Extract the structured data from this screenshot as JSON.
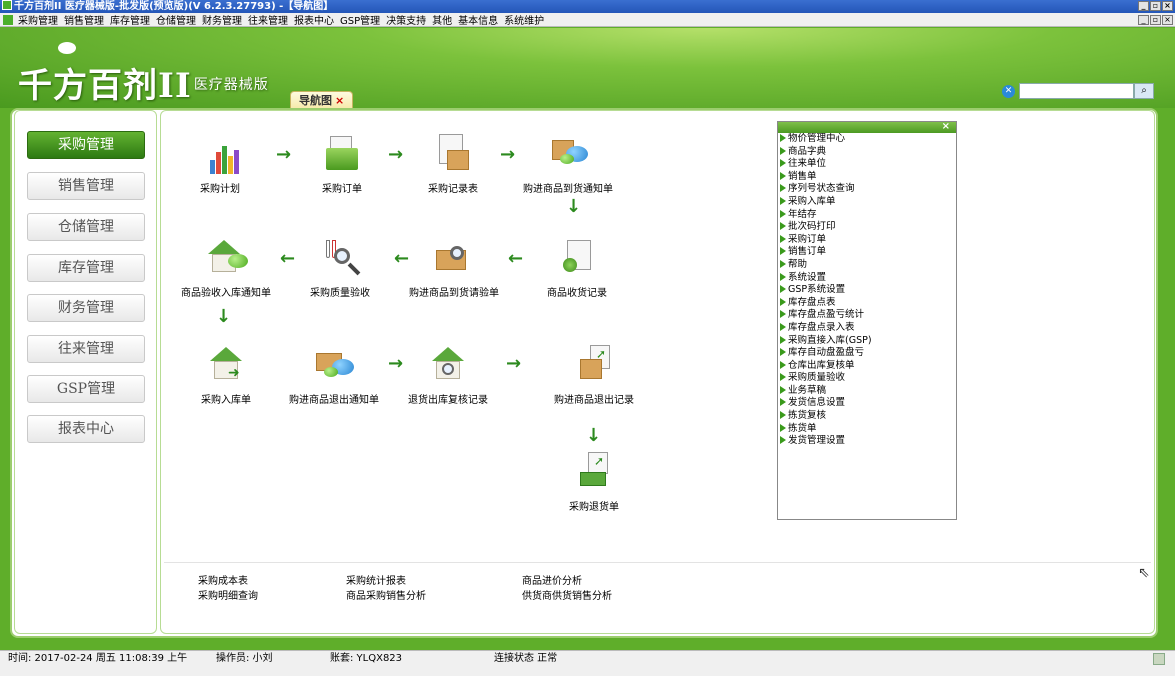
{
  "window": {
    "title": "千方百剂II 医疗器械版-批发版(预览版)(V 6.2.3.27793)  -【导航图】",
    "controls": [
      "_",
      "▫",
      "×"
    ]
  },
  "menubar": {
    "items": [
      "采购管理",
      "销售管理",
      "库存管理",
      "仓储管理",
      "财务管理",
      "往来管理",
      "报表中心",
      "GSP管理",
      "决策支持",
      "其他",
      "基本信息",
      "系统维护"
    ]
  },
  "header": {
    "logo_text": "千方百剂",
    "logo_roman": "II",
    "logo_sub": "医疗器械版",
    "tab_label": "导航图",
    "tab_close": "×",
    "search": {
      "placeholder": "",
      "value": ""
    }
  },
  "left_nav": {
    "items": [
      {
        "label": "采购管理",
        "active": true
      },
      {
        "label": "销售管理",
        "active": false
      },
      {
        "label": "仓储管理",
        "active": false
      },
      {
        "label": "库存管理",
        "active": false
      },
      {
        "label": "财务管理",
        "active": false
      },
      {
        "label": "往来管理",
        "active": false
      },
      {
        "label": "GSP管理",
        "active": false
      },
      {
        "label": "报表中心",
        "active": false
      }
    ]
  },
  "workflow": {
    "purchase_plan": "采购计划",
    "purchase_order": "采购订单",
    "purchase_record": "采购记录表",
    "arrival_notice": "购进商品到货通知单",
    "receipt_record": "商品收货记录",
    "inspection_request": "购进商品到货请验单",
    "quality_check": "采购质量验收",
    "inbound_notice": "商品验收入库通知单",
    "stock_in": "采购入库单",
    "return_notice": "购进商品退出通知单",
    "return_review": "退货出库复核记录",
    "return_record": "购进商品退出记录",
    "return_order": "采购退货单"
  },
  "side_list": {
    "close": "×",
    "items": [
      "物价管理中心",
      "商品字典",
      "往来单位",
      "销售单",
      "序列号状态查询",
      "采购入库单",
      "年结存",
      "批次码打印",
      "采购订单",
      "销售订单",
      "帮助",
      "系统设置",
      "GSP系统设置",
      "库存盘点表",
      "库存盘点盈亏统计",
      "库存盘点录入表",
      "采购直接入库(GSP)",
      "库存自动盘盈盘亏",
      "仓库出库复核单",
      "采购质量验收",
      "业务草稿",
      "发货信息设置",
      "拣货复核",
      "拣货单",
      "发货管理设置"
    ]
  },
  "bottom_links": {
    "col1": [
      "采购成本表",
      "采购明细查询"
    ],
    "col2": [
      "采购统计报表",
      "商品采购销售分析"
    ],
    "col3": [
      "商品进价分析",
      "供货商供货销售分析"
    ]
  },
  "status": {
    "time": "时间: 2017-02-24 周五 11:08:39 上午",
    "operator": "操作员: 小刘",
    "account": "账套: YLQX823",
    "connection": "连接状态 正常"
  },
  "colors": {
    "brand_green": "#4a9a1f",
    "accent_green": "#2c8a1e",
    "title_blue": "#2456b8"
  }
}
